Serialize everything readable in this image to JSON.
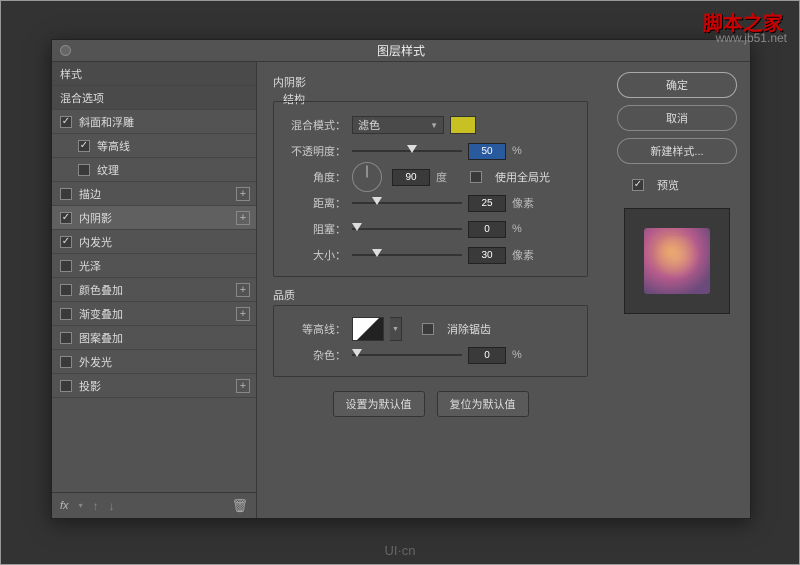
{
  "watermark": "脚本之家",
  "watermark_url": "www.jb51.net",
  "footer_logo": "UI·cn",
  "dialog": {
    "title": "图层样式"
  },
  "left": {
    "styles_label": "样式",
    "blending_label": "混合选项",
    "items": [
      {
        "label": "斜面和浮雕",
        "checked": true,
        "plus": false
      },
      {
        "label": "等高线",
        "checked": true,
        "plus": false,
        "indent": true
      },
      {
        "label": "纹理",
        "checked": false,
        "plus": false,
        "indent": true
      },
      {
        "label": "描边",
        "checked": false,
        "plus": true
      },
      {
        "label": "内阴影",
        "checked": true,
        "plus": true,
        "selected": true
      },
      {
        "label": "内发光",
        "checked": true,
        "plus": false
      },
      {
        "label": "光泽",
        "checked": false,
        "plus": false
      },
      {
        "label": "颜色叠加",
        "checked": false,
        "plus": true
      },
      {
        "label": "渐变叠加",
        "checked": false,
        "plus": true
      },
      {
        "label": "图案叠加",
        "checked": false,
        "plus": false
      },
      {
        "label": "外发光",
        "checked": false,
        "plus": false
      },
      {
        "label": "投影",
        "checked": false,
        "plus": true
      }
    ],
    "fx": "fx"
  },
  "center": {
    "panel_title": "内阴影",
    "structure_title": "结构",
    "blend_mode_label": "混合模式：",
    "blend_mode_value": "滤色",
    "opacity_label": "不透明度：",
    "opacity_value": "50",
    "opacity_unit": "%",
    "angle_label": "角度：",
    "angle_value": "90",
    "angle_unit": "度",
    "global_light_label": "使用全局光",
    "distance_label": "距离：",
    "distance_value": "25",
    "distance_unit": "像素",
    "choke_label": "阻塞：",
    "choke_value": "0",
    "choke_unit": "%",
    "size_label": "大小：",
    "size_value": "30",
    "size_unit": "像素",
    "quality_title": "品质",
    "contour_label": "等高线：",
    "antialias_label": "消除锯齿",
    "noise_label": "杂色：",
    "noise_value": "0",
    "noise_unit": "%",
    "default_btn": "设置为默认值",
    "reset_btn": "复位为默认值"
  },
  "right": {
    "ok": "确定",
    "cancel": "取消",
    "new_style": "新建样式...",
    "preview_label": "预览"
  }
}
